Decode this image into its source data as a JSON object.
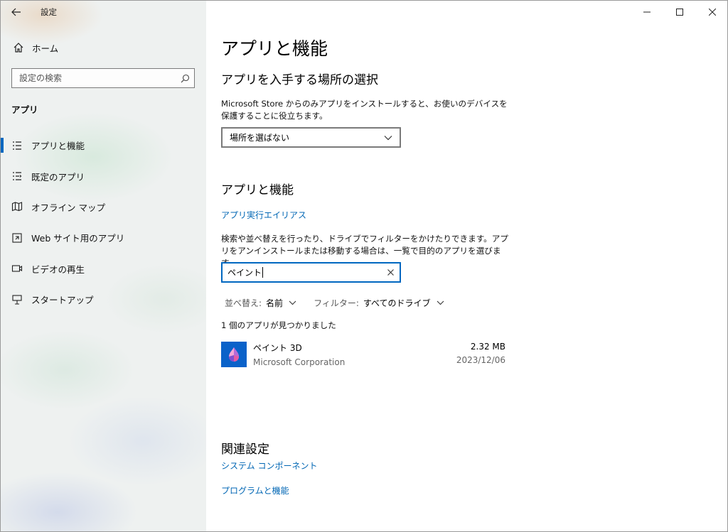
{
  "window": {
    "title": "設定"
  },
  "sidebar": {
    "home_label": "ホーム",
    "search_placeholder": "設定の検索",
    "section": "アプリ",
    "items": [
      {
        "label": "アプリと機能",
        "icon": "apps-list-icon",
        "active": true
      },
      {
        "label": "既定のアプリ",
        "icon": "default-apps-icon",
        "active": false
      },
      {
        "label": "オフライン マップ",
        "icon": "offline-map-icon",
        "active": false
      },
      {
        "label": "Web サイト用のアプリ",
        "icon": "website-apps-icon",
        "active": false
      },
      {
        "label": "ビデオの再生",
        "icon": "video-playback-icon",
        "active": false
      },
      {
        "label": "スタートアップ",
        "icon": "startup-icon",
        "active": false
      }
    ]
  },
  "main": {
    "page_title": "アプリと機能",
    "install_section": {
      "heading": "アプリを入手する場所の選択",
      "description": "Microsoft Store からのみアプリをインストールすると、お使いのデバイスを保護することに役立ちます。",
      "dropdown_value": "場所を選ばない"
    },
    "apps_section": {
      "heading": "アプリと機能",
      "alias_link": "アプリ実行エイリアス",
      "description": "検索や並べ替えを行ったり、ドライブでフィルターをかけたりできます。アプリをアンインストールまたは移動する場合は、一覧で目的のアプリを選びます。",
      "search_value": "ペイント",
      "sort_label": "並べ替え:",
      "sort_value": "名前",
      "filter_label": "フィルター:",
      "filter_value": "すべてのドライブ",
      "result_count": "1 個のアプリが見つかりました",
      "apps": [
        {
          "name": "ペイント 3D",
          "publisher": "Microsoft Corporation",
          "size": "2.32 MB",
          "date": "2023/12/06"
        }
      ]
    },
    "related": {
      "heading": "関連設定",
      "links": [
        "システム コンポーネント",
        "プログラムと機能"
      ]
    }
  },
  "colors": {
    "accent": "#0067c0",
    "link": "#0066b4",
    "app_icon_bg": "#0a62c9"
  }
}
